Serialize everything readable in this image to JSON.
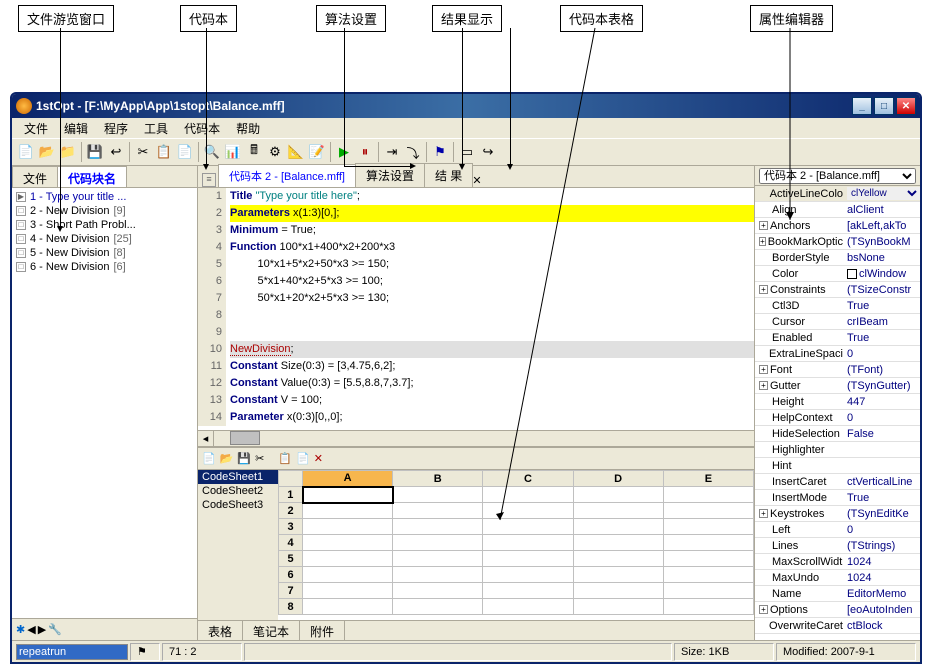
{
  "annotations": {
    "a0": "文件游览窗口",
    "a1": "代码本",
    "a2": "算法设置",
    "a3": "结果显示",
    "a4": "代码本表格",
    "a5": "属性编辑器"
  },
  "titlebar": {
    "title": "1stOpt - [F:\\MyApp\\App\\1stopt\\Balance.mff]"
  },
  "menubar": {
    "file": "文件",
    "edit": "编辑",
    "program": "程序",
    "tool": "工具",
    "codebook": "代码本",
    "help": "帮助"
  },
  "lpTabs": {
    "file": "文件",
    "block": "代码块名"
  },
  "lpItems": [
    {
      "idx": "1",
      "txt": "Type your title ...",
      "sel": true,
      "icon": "▶"
    },
    {
      "idx": "2",
      "txt": "New Division",
      "num": "[9]"
    },
    {
      "idx": "3",
      "txt": "Short Path Probl...",
      "num": ""
    },
    {
      "idx": "4",
      "txt": "New Division",
      "num": "[25]"
    },
    {
      "idx": "5",
      "txt": "New Division",
      "num": "[8]"
    },
    {
      "idx": "6",
      "txt": "New Division",
      "num": "[6]"
    }
  ],
  "cpTabs": {
    "codebookPrefix": "代码本 2 - ",
    "codebookFile": "[Balance.mff]",
    "algo": "算法设置",
    "result": "结 果"
  },
  "code": {
    "lines": [
      {
        "n": "1",
        "html": "<span class='kw'>Title</span> <span class='str'>\"Type your title here\"</span>;",
        "cls": ""
      },
      {
        "n": "2",
        "html": "<span class='kw'>Parameters</span> x(1:3)[0,];",
        "cls": "cur-ln"
      },
      {
        "n": "3",
        "html": "<span class='kw'>Minimum</span> = True;",
        "cls": ""
      },
      {
        "n": "4",
        "html": "<span class='kw'>Function</span> 100*x1+400*x2+200*x3",
        "cls": ""
      },
      {
        "n": "5",
        "html": "         10*x1+5*x2+50*x3 &gt;= 150;",
        "cls": ""
      },
      {
        "n": "6",
        "html": "         5*x1+40*x2+5*x3 &gt;= 100;",
        "cls": ""
      },
      {
        "n": "7",
        "html": "         50*x1+20*x2+5*x3 &gt;= 130;",
        "cls": ""
      },
      {
        "n": "8",
        "html": "",
        "cls": ""
      },
      {
        "n": "9",
        "html": "",
        "cls": ""
      },
      {
        "n": "10",
        "html": "<span class='nd'>NewDivision</span>;",
        "cls": "",
        "hl": "grey"
      },
      {
        "n": "11",
        "html": "<span class='kw'>Constant</span> Size(0:3) = [3,4.75,6,2];",
        "cls": ""
      },
      {
        "n": "12",
        "html": "<span class='kw'>Constant</span> Value(0:3) = [5.5,8.8,7,3.7];",
        "cls": ""
      },
      {
        "n": "13",
        "html": "<span class='kw'>Constant</span> V = 100;",
        "cls": ""
      },
      {
        "n": "14",
        "html": "<span class='kw'>Parameter</span> x(0:3)[0,,0];",
        "cls": ""
      }
    ]
  },
  "sheet": {
    "nav": [
      "CodeSheet1",
      "CodeSheet2",
      "CodeSheet3"
    ],
    "cols": [
      "A",
      "B",
      "C",
      "D",
      "E"
    ],
    "rows": [
      "1",
      "2",
      "3",
      "4",
      "5",
      "6",
      "7",
      "8"
    ],
    "tabs": {
      "grid": "表格",
      "note": "笔记本",
      "attach": "附件"
    }
  },
  "props": {
    "sel": "代码本 2 - [Balance.mff]",
    "rows": [
      {
        "k": "ActiveLineColo",
        "v": "clYellow",
        "sel": true,
        "dd": true
      },
      {
        "k": "Align",
        "v": "alClient"
      },
      {
        "k": "Anchors",
        "v": "[akLeft,akTo",
        "exp": "+"
      },
      {
        "k": "BookMarkOptic",
        "v": "(TSynBookM",
        "exp": "+"
      },
      {
        "k": "BorderStyle",
        "v": "bsNone"
      },
      {
        "k": "Color",
        "v": "clWindow",
        "sw": true
      },
      {
        "k": "Constraints",
        "v": "(TSizeConstr",
        "exp": "+"
      },
      {
        "k": "Ctl3D",
        "v": "True"
      },
      {
        "k": "Cursor",
        "v": "crIBeam"
      },
      {
        "k": "Enabled",
        "v": "True"
      },
      {
        "k": "ExtraLineSpaci",
        "v": "0"
      },
      {
        "k": "Font",
        "v": "(TFont)",
        "exp": "+"
      },
      {
        "k": "Gutter",
        "v": "(TSynGutter)",
        "exp": "+"
      },
      {
        "k": "Height",
        "v": "447"
      },
      {
        "k": "HelpContext",
        "v": "0"
      },
      {
        "k": "HideSelection",
        "v": "False"
      },
      {
        "k": "Highlighter",
        "v": ""
      },
      {
        "k": "Hint",
        "v": ""
      },
      {
        "k": "InsertCaret",
        "v": "ctVerticalLine"
      },
      {
        "k": "InsertMode",
        "v": "True"
      },
      {
        "k": "Keystrokes",
        "v": "(TSynEditKe",
        "exp": "+"
      },
      {
        "k": "Left",
        "v": "0"
      },
      {
        "k": "Lines",
        "v": "(TStrings)"
      },
      {
        "k": "MaxScrollWidt",
        "v": "1024"
      },
      {
        "k": "MaxUndo",
        "v": "1024"
      },
      {
        "k": "Name",
        "v": "EditorMemo"
      },
      {
        "k": "Options",
        "v": "[eoAutoInden",
        "exp": "+"
      },
      {
        "k": "OverwriteCaret",
        "v": "ctBlock"
      }
    ]
  },
  "statusbar": {
    "input": "repeatrun",
    "pos": "71 :  2",
    "size": "Size: 1KB",
    "modified": "Modified: 2007-9-1"
  }
}
